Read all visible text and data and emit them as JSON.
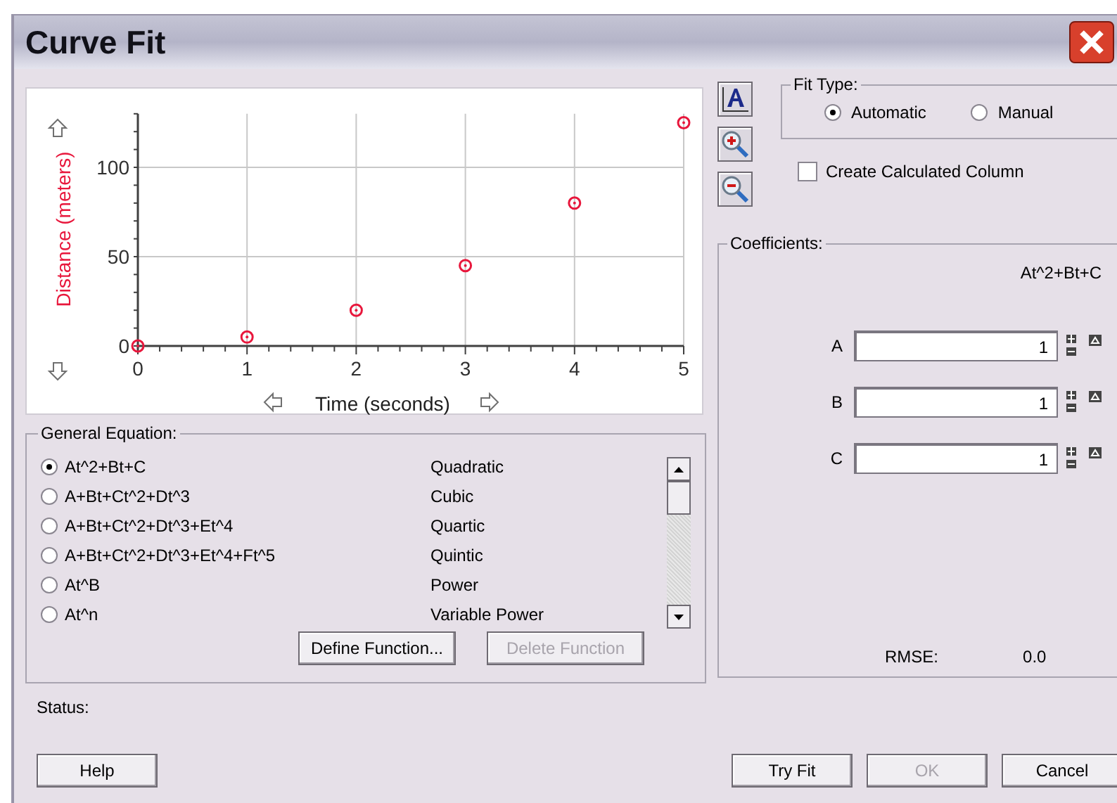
{
  "window": {
    "title": "Curve Fit"
  },
  "graph": {
    "chart_data": {
      "type": "scatter",
      "xlabel": "Time (seconds)",
      "ylabel": "Distance (meters)",
      "x": [
        0,
        1,
        2,
        3,
        4,
        5
      ],
      "series": [
        {
          "color": "#e8173c",
          "values": [
            0,
            5,
            20,
            45,
            80,
            125
          ]
        }
      ],
      "xlim": [
        0,
        5
      ],
      "ylim": [
        0,
        130
      ],
      "xticks": [
        0,
        1,
        2,
        3,
        4,
        5
      ],
      "yticks": [
        0,
        50,
        100
      ],
      "grid": true
    }
  },
  "general_equation": {
    "title": "General Equation:",
    "items": [
      {
        "equation": "At^2+Bt+C",
        "name": "Quadratic",
        "selected": true
      },
      {
        "equation": "A+Bt+Ct^2+Dt^3",
        "name": "Cubic",
        "selected": false
      },
      {
        "equation": "A+Bt+Ct^2+Dt^3+Et^4",
        "name": "Quartic",
        "selected": false
      },
      {
        "equation": "A+Bt+Ct^2+Dt^3+Et^4+Ft^5",
        "name": "Quintic",
        "selected": false
      },
      {
        "equation": "At^B",
        "name": "Power",
        "selected": false
      },
      {
        "equation": "At^n",
        "name": "Variable Power",
        "selected": false
      }
    ],
    "buttons": [
      {
        "label": "Define Function...",
        "disabled": false
      },
      {
        "label": "Delete Function",
        "disabled": true
      }
    ]
  },
  "fit_type": {
    "title": "Fit Type:",
    "options": [
      {
        "label": "Automatic",
        "selected": true
      },
      {
        "label": "Manual",
        "selected": false
      }
    ]
  },
  "create_calculated_column": {
    "label": "Create Calculated Column",
    "checked": false
  },
  "coefficients": {
    "title": "Coefficients:",
    "formula": "At^2+Bt+C",
    "rows": [
      {
        "label": "A",
        "value": "1"
      },
      {
        "label": "B",
        "value": "1"
      },
      {
        "label": "C",
        "value": "1"
      }
    ],
    "rmse_label": "RMSE:",
    "rmse_value": "0.0"
  },
  "status": {
    "label": "Status:"
  },
  "buttons": [
    {
      "label": "Help",
      "disabled": false
    },
    {
      "label": "Try Fit",
      "disabled": false
    },
    {
      "label": "OK",
      "disabled": true
    },
    {
      "label": "Cancel",
      "disabled": false
    }
  ]
}
